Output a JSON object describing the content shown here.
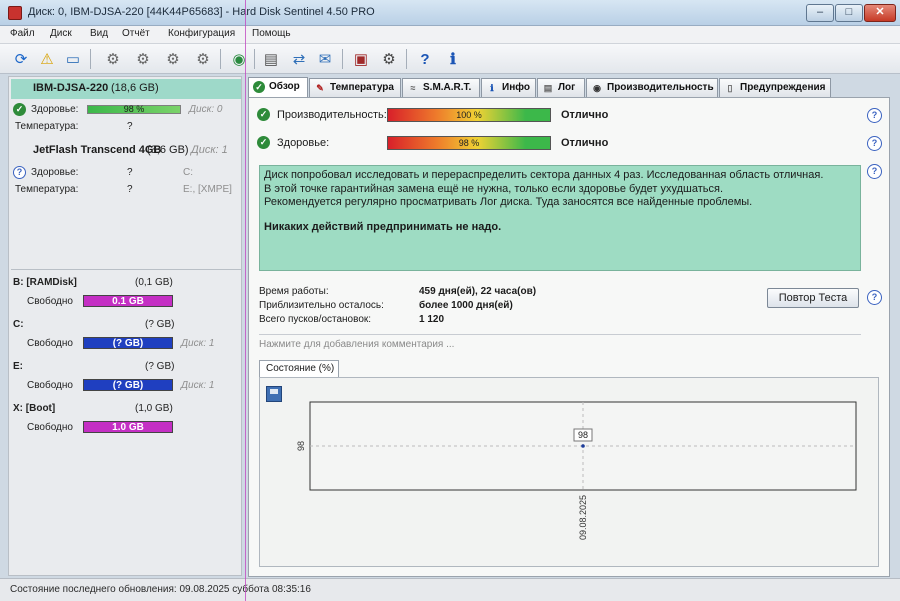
{
  "window": {
    "title": "Диск: 0, IBM-DJSA-220 [44K44P65683]  -  Hard Disk Sentinel 4.50 PRO"
  },
  "menu": [
    "Файл",
    "Диск",
    "Вид",
    "Отчёт",
    "Конфигурация",
    "Помощь"
  ],
  "disks": [
    {
      "name": "IBM-DJSA-220",
      "size": "(18,6 GB)",
      "health_label": "Здоровье:",
      "health_value": "98 %",
      "health_pct": 98,
      "disk_index": "Диск: 0",
      "temp_label": "Температура:",
      "temp_value": "?"
    },
    {
      "name": "JetFlash Transcend 4GB",
      "size": "(3,6 GB)",
      "disk_index": "Диск: 1",
      "health_label": "Здоровье:",
      "health_value": "?",
      "health_extra": "C:",
      "temp_label": "Температура:",
      "temp_value": "?",
      "temp_extra": "E:, [XMPE]"
    }
  ],
  "volumes": [
    {
      "name": "B: [RAMDisk]",
      "size": "(0,1 GB)",
      "free_label": "Свободно",
      "free_value": "0.1 GB",
      "color": "#c42fc4",
      "disk": ""
    },
    {
      "name": "C:",
      "size": "(? GB)",
      "free_label": "Свободно",
      "free_value": "(? GB)",
      "color": "#1f3fc0",
      "disk": "Диск: 1"
    },
    {
      "name": "E:",
      "size": "(? GB)",
      "free_label": "Свободно",
      "free_value": "(? GB)",
      "color": "#1f3fc0",
      "disk": "Диск: 1"
    },
    {
      "name": "X: [Boot]",
      "size": "(1,0 GB)",
      "free_label": "Свободно",
      "free_value": "1.0 GB",
      "color": "#c42fc4",
      "disk": ""
    }
  ],
  "tabs": [
    "Обзор",
    "Температура",
    "S.M.A.R.T.",
    "Инфо",
    "Лог",
    "Производительность",
    "Предупреждения"
  ],
  "overview": {
    "performance_label": "Производительность:",
    "performance_value": "100 %",
    "performance_pct": 100,
    "performance_status": "Отлично",
    "health_label": "Здоровье:",
    "health_value": "98 %",
    "health_pct": 98,
    "health_status": "Отлично",
    "info_lines": [
      "Диск попробовал исследовать и перераспределить сектора данных 4 раз. Исследованная область отличная.",
      "В этой точке гарантийная замена ещё не нужна, только если здоровье будет ухудшаться.",
      "Рекомендуется регулярно просматривать Лог диска. Туда заносятся все найденные проблемы."
    ],
    "info_bold": "Никаких действий предпринимать не надо.",
    "uptime_label": "Время работы:",
    "uptime_value": "459 дня(ей), 22 часа(ов)",
    "remaining_label": "Приблизительно осталось:",
    "remaining_value": "более 1000 дня(ей)",
    "starts_label": "Всего пусков/остановок:",
    "starts_value": "1 120",
    "retest_button": "Повтор Теста",
    "comment_placeholder": "Нажмите для добавления комментария ..."
  },
  "state_tab": "Состояние (%)",
  "chart_data": {
    "type": "line",
    "x": [
      "09.08.2025"
    ],
    "series": [
      {
        "values": [
          98
        ]
      }
    ],
    "ytick": "98",
    "point_label": "98",
    "xtick": "09.08.2025"
  },
  "statusbar": {
    "text": "Состояние последнего обновления: 09.08.2025 суббота 08:35:16"
  }
}
